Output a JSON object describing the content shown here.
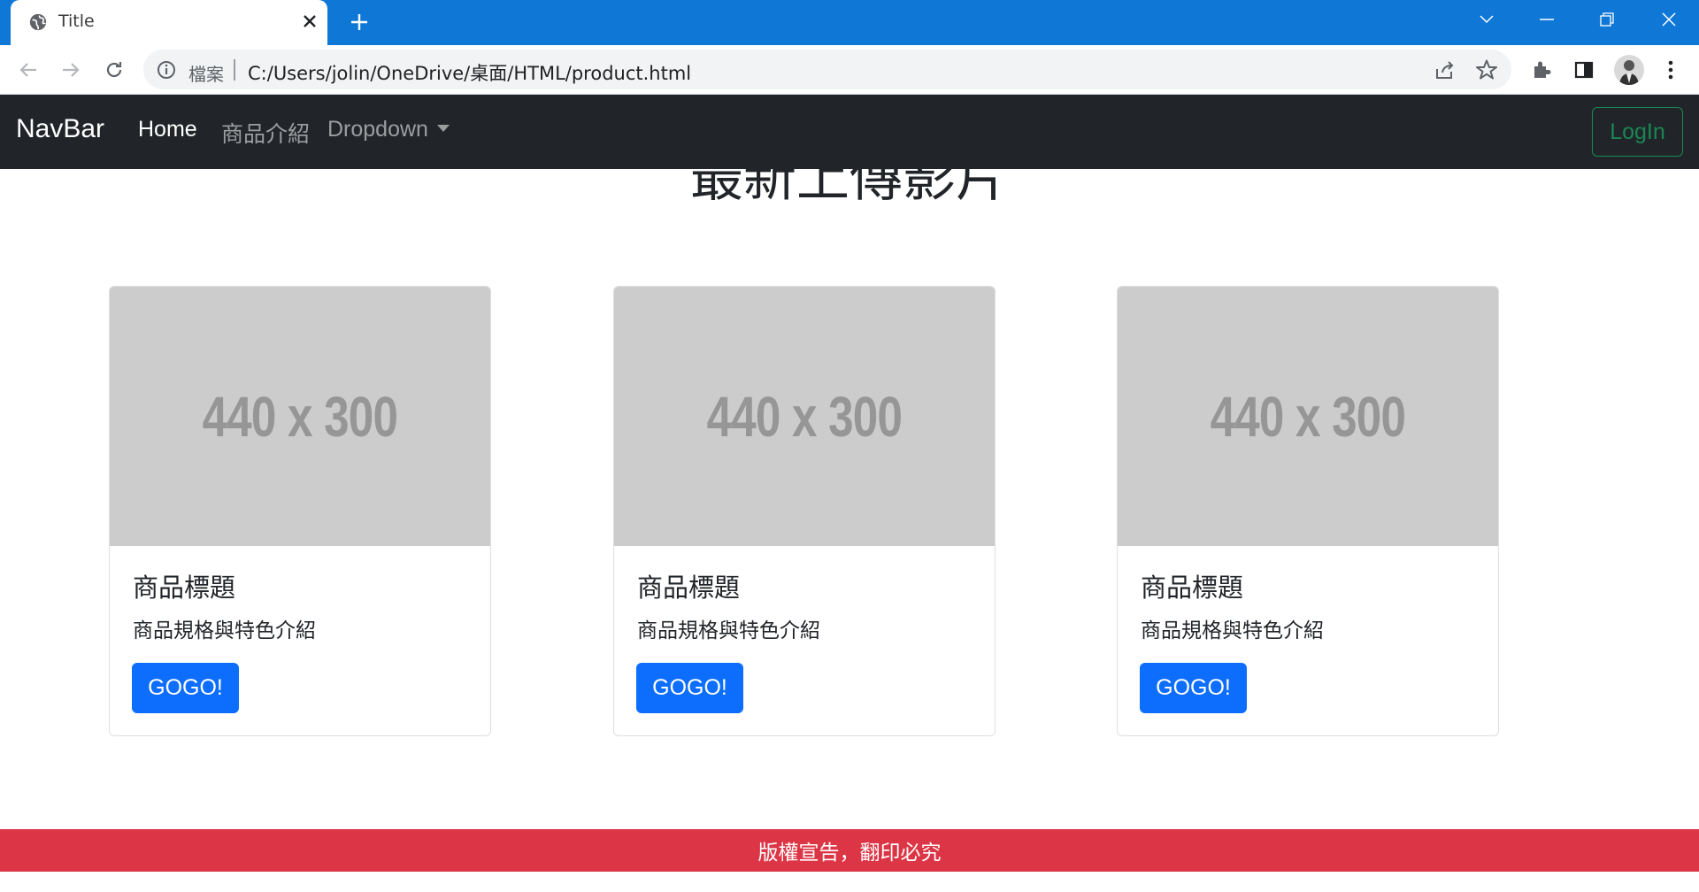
{
  "browser": {
    "tab_title": "Title",
    "address_scheme": "檔案",
    "address_url": "C:/Users/jolin/OneDrive/桌面/HTML/product.html",
    "tab_strip_color": "#0f78d7"
  },
  "navbar": {
    "brand": "NavBar",
    "items": [
      {
        "label": "Home",
        "active": true
      },
      {
        "label": "商品介紹",
        "active": false
      },
      {
        "label": "Dropdown",
        "active": false
      }
    ],
    "login_label": "LogIn",
    "background": "#212529"
  },
  "main": {
    "section_title": "最新上傳影片",
    "cards": [
      {
        "image_placeholder": "440 x 300",
        "title": "商品標題",
        "text": "商品規格與特色介紹",
        "button": "GOGO!"
      },
      {
        "image_placeholder": "440 x 300",
        "title": "商品標題",
        "text": "商品規格與特色介紹",
        "button": "GOGO!"
      },
      {
        "image_placeholder": "440 x 300",
        "title": "商品標題",
        "text": "商品規格與特色介紹",
        "button": "GOGO!"
      }
    ]
  },
  "footer": {
    "text": "版權宣告，翻印必究",
    "background": "#dc3545"
  },
  "colors": {
    "primary_button": "#0d6efd",
    "login_outline": "#198754"
  }
}
